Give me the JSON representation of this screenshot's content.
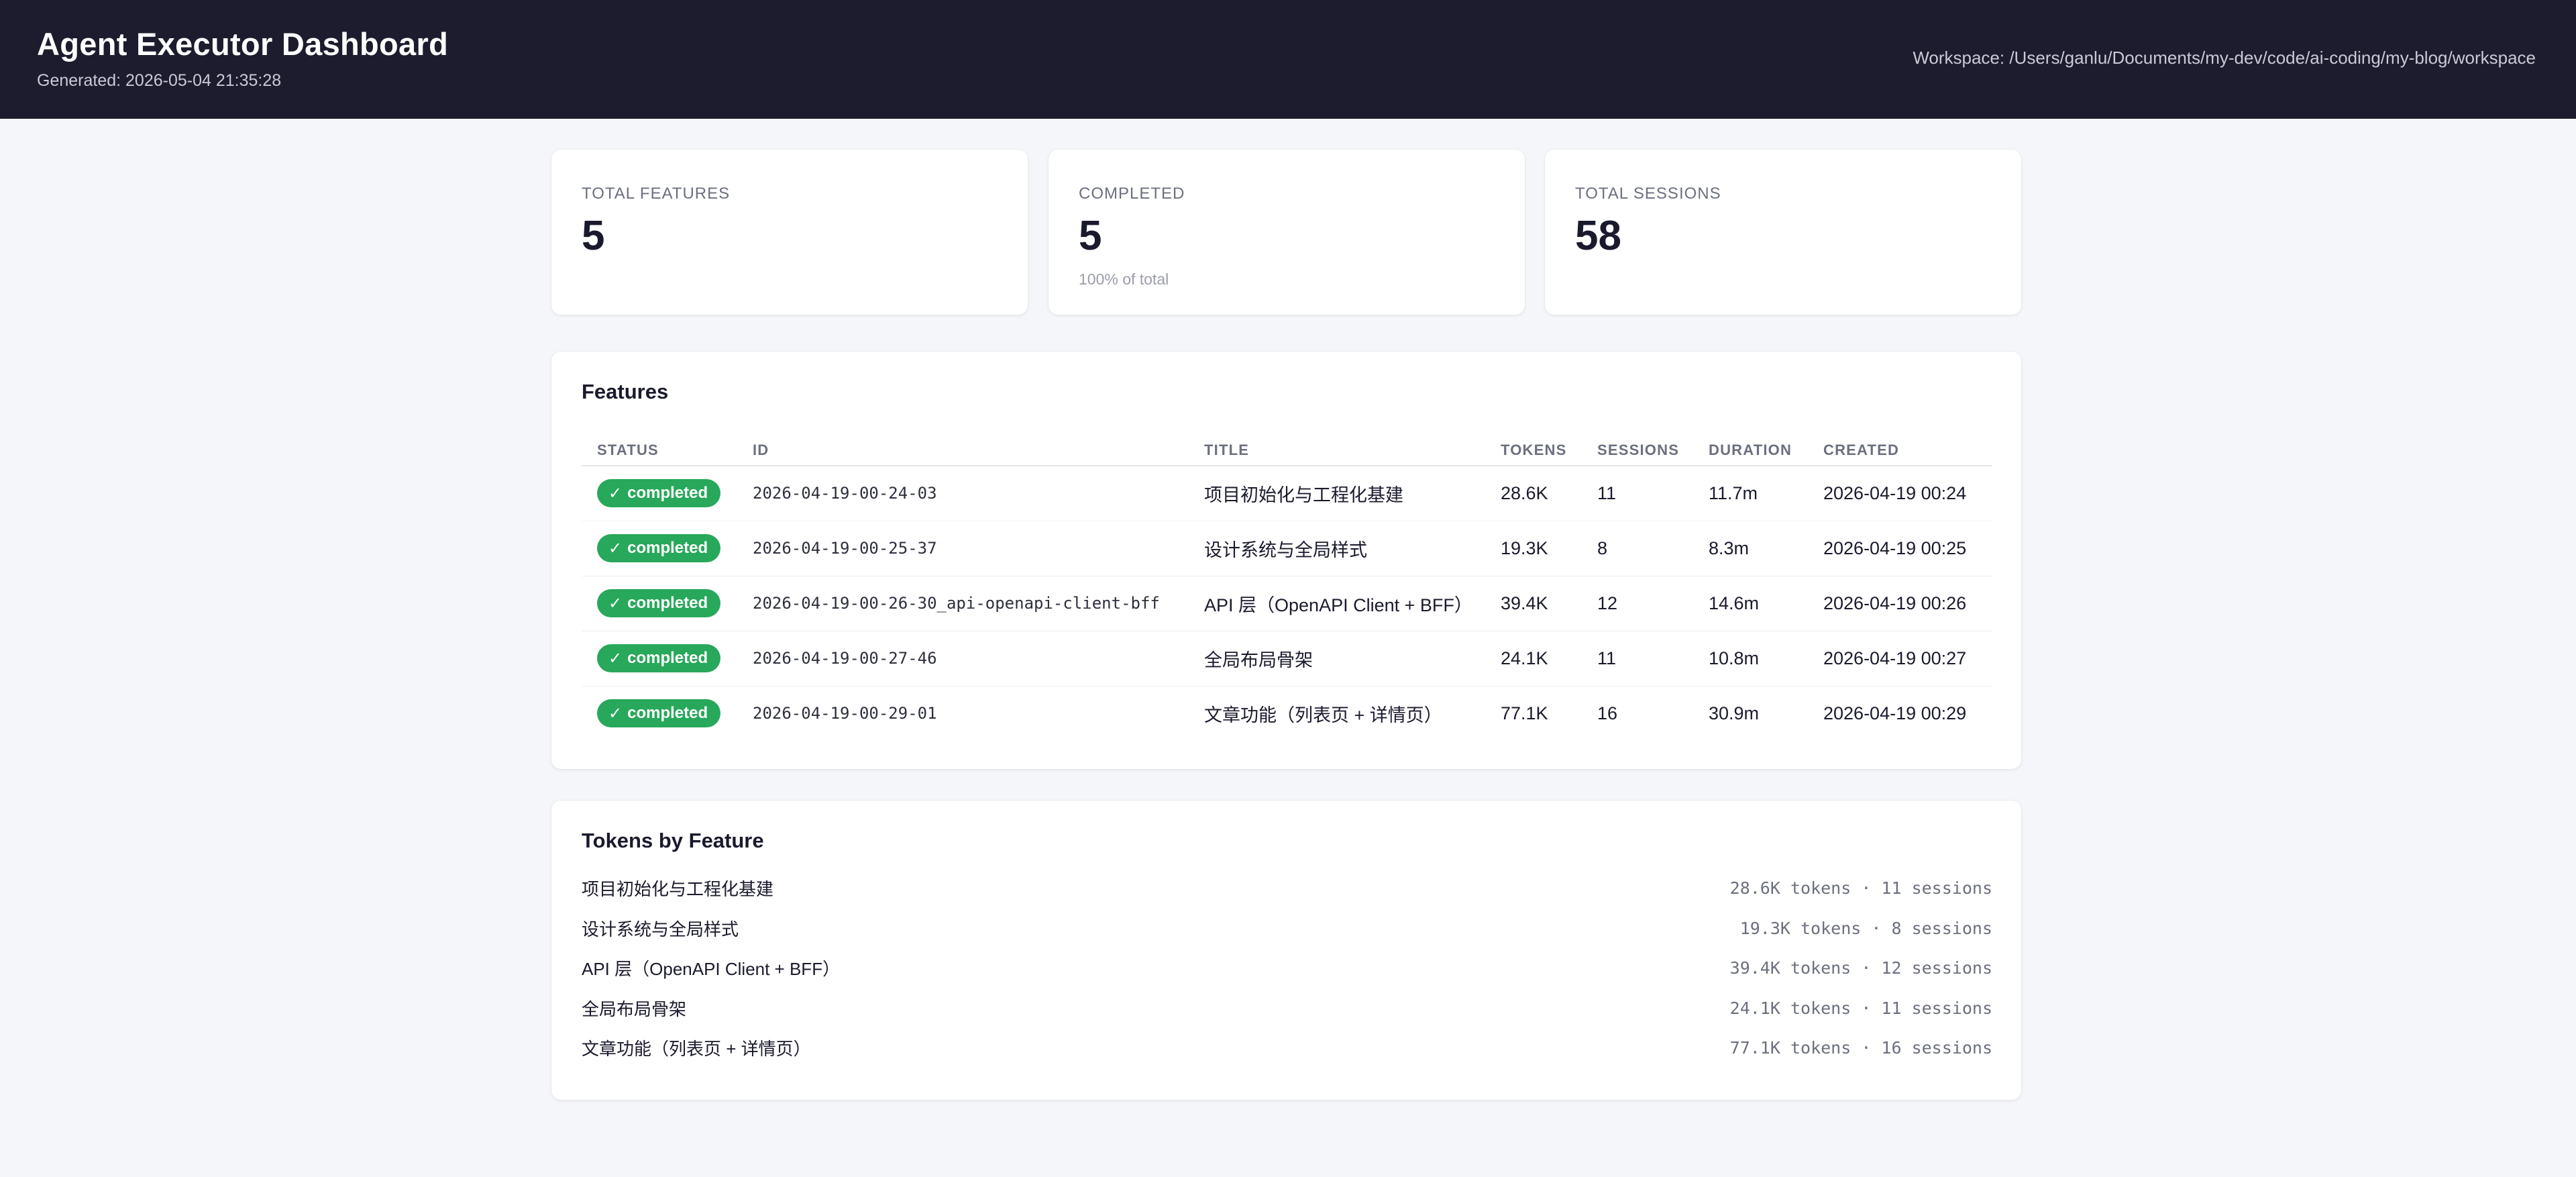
{
  "header": {
    "title": "Agent Executor Dashboard",
    "generated": "Generated: 2026-05-04 21:35:28",
    "workspace": "Workspace: /Users/ganlu/Documents/my-dev/code/ai-coding/my-blog/workspace"
  },
  "stats": [
    {
      "label": "TOTAL FEATURES",
      "value": "5",
      "sub": ""
    },
    {
      "label": "COMPLETED",
      "value": "5",
      "sub": "100% of total"
    },
    {
      "label": "TOTAL SESSIONS",
      "value": "58",
      "sub": ""
    }
  ],
  "features": {
    "title": "Features",
    "columns": [
      "STATUS",
      "ID",
      "TITLE",
      "TOKENS",
      "SESSIONS",
      "DURATION",
      "CREATED"
    ],
    "rows": [
      {
        "status": "completed",
        "id": "2026-04-19-00-24-03",
        "title": "项目初始化与工程化基建",
        "tokens": "28.6K",
        "sessions": "11",
        "duration": "11.7m",
        "created": "2026-04-19 00:24"
      },
      {
        "status": "completed",
        "id": "2026-04-19-00-25-37",
        "title": "设计系统与全局样式",
        "tokens": "19.3K",
        "sessions": "8",
        "duration": "8.3m",
        "created": "2026-04-19 00:25"
      },
      {
        "status": "completed",
        "id": "2026-04-19-00-26-30_api-openapi-client-bff",
        "title": "API 层（OpenAPI Client + BFF）",
        "tokens": "39.4K",
        "sessions": "12",
        "duration": "14.6m",
        "created": "2026-04-19 00:26"
      },
      {
        "status": "completed",
        "id": "2026-04-19-00-27-46",
        "title": "全局布局骨架",
        "tokens": "24.1K",
        "sessions": "11",
        "duration": "10.8m",
        "created": "2026-04-19 00:27"
      },
      {
        "status": "completed",
        "id": "2026-04-19-00-29-01",
        "title": "文章功能（列表页 + 详情页）",
        "tokens": "77.1K",
        "sessions": "16",
        "duration": "30.9m",
        "created": "2026-04-19 00:29"
      }
    ]
  },
  "tokens_by_feature": {
    "title": "Tokens by Feature",
    "items": [
      {
        "name": "项目初始化与工程化基建",
        "stat": "28.6K tokens · 11 sessions"
      },
      {
        "name": "设计系统与全局样式",
        "stat": "19.3K tokens · 8 sessions"
      },
      {
        "name": "API 层（OpenAPI Client + BFF）",
        "stat": "39.4K tokens · 12 sessions"
      },
      {
        "name": "全局布局骨架",
        "stat": "24.1K tokens · 11 sessions"
      },
      {
        "name": "文章功能（列表页 + 详情页）",
        "stat": "77.1K tokens · 16 sessions"
      }
    ]
  },
  "colors": {
    "header_bg": "#1c1c2e",
    "completed_badge": "#27a85a",
    "page_bg": "#f5f6f9"
  }
}
